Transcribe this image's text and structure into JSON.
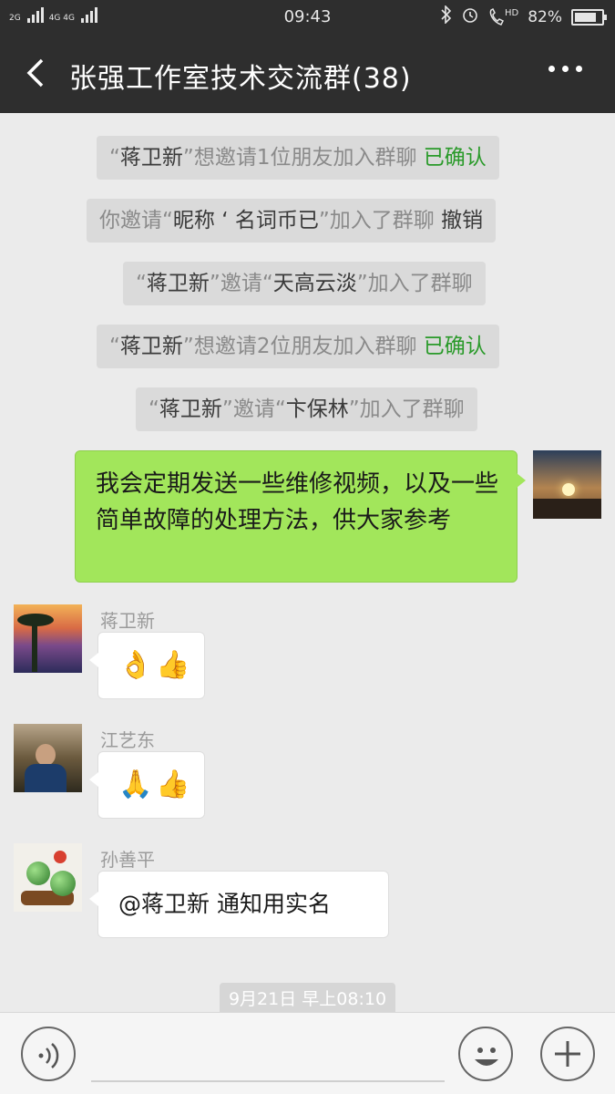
{
  "status_bar": {
    "network_left": "2G",
    "network_right": "4G 4G",
    "time": "09:43",
    "signal_extra": "HD",
    "battery_percent_text": "82%",
    "battery_level": 0.82
  },
  "header": {
    "title": "张强工作室技术交流群(38)"
  },
  "notices": [
    {
      "parts": [
        "“",
        "蒋卫新",
        "”想邀请1位朋友加入群聊 "
      ],
      "action": "已确认"
    },
    {
      "parts": [
        "你邀请“",
        "昵称  ‘  名词币已",
        "”加入了群聊 "
      ],
      "action": "撤销"
    },
    {
      "parts": [
        "“",
        "蒋卫新",
        "”邀请“",
        "天高云淡",
        "”加入了群聊"
      ]
    },
    {
      "parts": [
        "“",
        "蒋卫新",
        "”想邀请2位朋友加入群聊 "
      ],
      "action": "已确认"
    },
    {
      "parts": [
        "“",
        "蒋卫新",
        "”邀请“",
        "卞保林",
        "”加入了群聊"
      ]
    }
  ],
  "my_message": {
    "text": "我会定期发送一些维修视频，以及一些简单故障的处理方法，供大家参考"
  },
  "messages": [
    {
      "sender": "蒋卫新",
      "content": "👌👍"
    },
    {
      "sender": "江艺东",
      "content": "🙏👍"
    },
    {
      "sender": "孙善平",
      "content": "@蒋卫新  通知用实名"
    }
  ],
  "timestamp": "9月21日 早上08:10",
  "input_bar": {
    "placeholder": ""
  },
  "icons": {
    "back": "back-arrow-icon",
    "more": "more-dots-icon",
    "voice": "voice-icon",
    "emoji": "emoji-icon",
    "plus": "plus-icon"
  }
}
